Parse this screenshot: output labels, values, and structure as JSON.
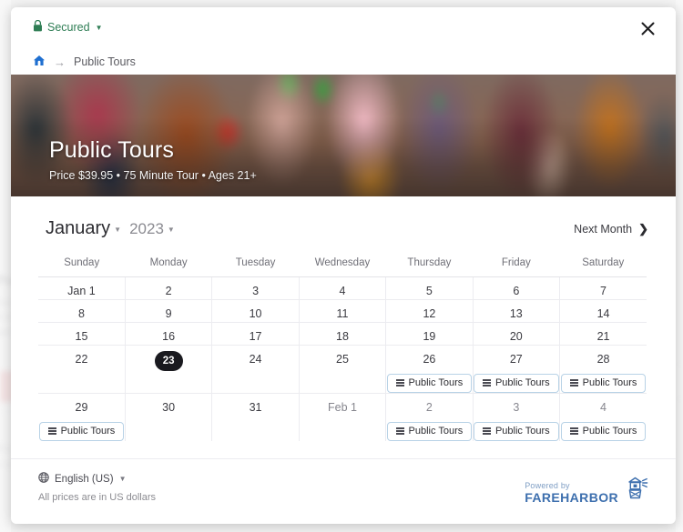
{
  "modal": {
    "secured_label": "Secured",
    "secured_icon": "lock-icon",
    "close_icon": "close-icon"
  },
  "breadcrumb": {
    "home_icon": "home-icon",
    "separator": "→",
    "current": "Public Tours"
  },
  "hero": {
    "title": "Public Tours",
    "subtitle": "Price $39.95 • 75 Minute Tour • Ages 21+"
  },
  "calendar": {
    "month": "January",
    "year": "2023",
    "next_month_label": "Next Month",
    "next_month_icon": "chevron-right-icon",
    "weekdays": [
      "Sunday",
      "Monday",
      "Tuesday",
      "Wednesday",
      "Thursday",
      "Friday",
      "Saturday"
    ],
    "slot_label": "Public Tours",
    "slot_icon": "list-lines-icon",
    "today": "23",
    "weeks": [
      [
        {
          "day": "Jan 1",
          "out": false,
          "today": false,
          "slot": false
        },
        {
          "day": "2",
          "out": false,
          "today": false,
          "slot": false
        },
        {
          "day": "3",
          "out": false,
          "today": false,
          "slot": false
        },
        {
          "day": "4",
          "out": false,
          "today": false,
          "slot": false
        },
        {
          "day": "5",
          "out": false,
          "today": false,
          "slot": false
        },
        {
          "day": "6",
          "out": false,
          "today": false,
          "slot": false
        },
        {
          "day": "7",
          "out": false,
          "today": false,
          "slot": false
        }
      ],
      [
        {
          "day": "8",
          "out": false,
          "today": false,
          "slot": false
        },
        {
          "day": "9",
          "out": false,
          "today": false,
          "slot": false
        },
        {
          "day": "10",
          "out": false,
          "today": false,
          "slot": false
        },
        {
          "day": "11",
          "out": false,
          "today": false,
          "slot": false
        },
        {
          "day": "12",
          "out": false,
          "today": false,
          "slot": false
        },
        {
          "day": "13",
          "out": false,
          "today": false,
          "slot": false
        },
        {
          "day": "14",
          "out": false,
          "today": false,
          "slot": false
        }
      ],
      [
        {
          "day": "15",
          "out": false,
          "today": false,
          "slot": false
        },
        {
          "day": "16",
          "out": false,
          "today": false,
          "slot": false
        },
        {
          "day": "17",
          "out": false,
          "today": false,
          "slot": false
        },
        {
          "day": "18",
          "out": false,
          "today": false,
          "slot": false
        },
        {
          "day": "19",
          "out": false,
          "today": false,
          "slot": false
        },
        {
          "day": "20",
          "out": false,
          "today": false,
          "slot": false
        },
        {
          "day": "21",
          "out": false,
          "today": false,
          "slot": false
        }
      ],
      [
        {
          "day": "22",
          "out": false,
          "today": false,
          "slot": false
        },
        {
          "day": "23",
          "out": false,
          "today": true,
          "slot": false
        },
        {
          "day": "24",
          "out": false,
          "today": false,
          "slot": false
        },
        {
          "day": "25",
          "out": false,
          "today": false,
          "slot": false
        },
        {
          "day": "26",
          "out": false,
          "today": false,
          "slot": true
        },
        {
          "day": "27",
          "out": false,
          "today": false,
          "slot": true
        },
        {
          "day": "28",
          "out": false,
          "today": false,
          "slot": true
        }
      ],
      [
        {
          "day": "29",
          "out": false,
          "today": false,
          "slot": true
        },
        {
          "day": "30",
          "out": false,
          "today": false,
          "slot": false
        },
        {
          "day": "31",
          "out": false,
          "today": false,
          "slot": false
        },
        {
          "day": "Feb 1",
          "out": true,
          "today": false,
          "slot": false
        },
        {
          "day": "2",
          "out": true,
          "today": false,
          "slot": true
        },
        {
          "day": "3",
          "out": true,
          "today": false,
          "slot": true
        },
        {
          "day": "4",
          "out": true,
          "today": false,
          "slot": true
        }
      ]
    ]
  },
  "footer": {
    "language": "English (US)",
    "language_icon": "globe-icon",
    "currency_note": "All prices are in US dollars",
    "powered_by": "Powered by",
    "brand": "FAREHARBOR",
    "brand_icon": "lighthouse-icon"
  },
  "colors": {
    "secured_green": "#2e7d54",
    "breadcrumb_home_blue": "#1f6fd0",
    "today_pill": "#1a1a1f",
    "slot_border": "#b8d2e6",
    "fareharbor_blue": "#3d6fae",
    "out_of_month_bg": "#f1f2f3"
  }
}
